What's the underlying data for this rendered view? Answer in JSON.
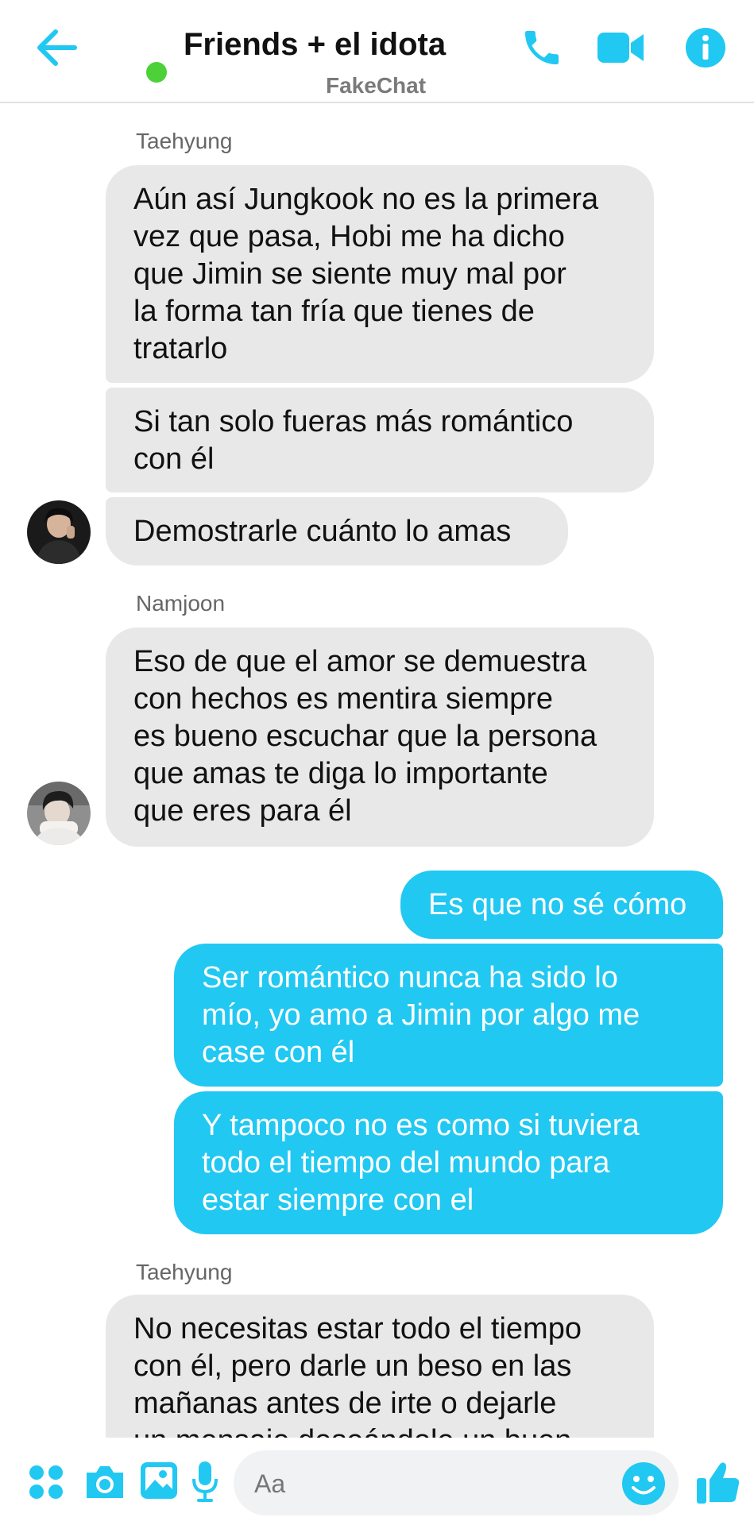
{
  "header": {
    "title": "Friends + el idota",
    "subtitle": "FakeChat"
  },
  "colors": {
    "accent": "#21c8f2",
    "online": "#4cd138",
    "incoming_bubble": "#e8e8e8"
  },
  "messages": [
    {
      "sender": "Taehyung",
      "direction": "incoming",
      "texts": [
        "Aún así Jungkook no es la primera\nvez que pasa, Hobi me ha dicho\nque Jimin se siente muy mal por\nla forma tan fría que tienes de\ntratarlo",
        "Si tan solo fueras más romántico\ncon él",
        "Demostrarle cuánto lo amas"
      ]
    },
    {
      "sender": "Namjoon",
      "direction": "incoming",
      "texts": [
        "Eso de que el amor se demuestra\ncon hechos es mentira siempre\nes bueno escuchar que la persona\nque amas te diga lo importante\nque eres para él"
      ]
    },
    {
      "sender": "",
      "direction": "outgoing",
      "texts": [
        "Es que no sé cómo",
        "Ser romántico nunca ha sido lo\nmío, yo amo a Jimin por algo me\ncase con él",
        "Y tampoco no es como si tuviera\ntodo el tiempo del mundo para\nestar siempre con el"
      ]
    },
    {
      "sender": "Taehyung",
      "direction": "incoming",
      "texts": [
        "No necesitas estar todo el tiempo\ncon él, pero darle un beso en las\nmañanas antes de irte o dejarle\nun mensaje deseándole un buen"
      ]
    }
  ],
  "composer": {
    "placeholder": "Aa"
  },
  "icons": {
    "back": "arrow-left-icon",
    "call": "phone-icon",
    "video": "video-camera-icon",
    "info": "info-icon",
    "apps": "four-dots-icon",
    "camera": "camera-icon",
    "gallery": "image-icon",
    "mic": "microphone-icon",
    "emoji": "smiley-icon",
    "like": "thumbs-up-icon"
  }
}
